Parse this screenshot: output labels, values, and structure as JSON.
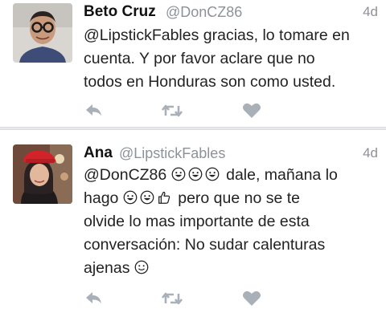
{
  "colors": {
    "name": "#111111",
    "meta": "#8d9299",
    "text": "#222222",
    "action_icon": "#a9b0b8",
    "divider": "#e6e9ec"
  },
  "tweets": [
    {
      "name": "Beto Cruz",
      "handle": "@DonCZ86",
      "time": "4d",
      "lines": [
        "@LipstickFables gracias, lo tomare en",
        "cuenta. Y por favor aclare que no",
        "todos en Honduras son como usted."
      ],
      "actions": [
        "reply-icon",
        "retweet-icon",
        "like-icon"
      ]
    },
    {
      "name": "Ana",
      "handle": "@LipstickFables",
      "time": "4d",
      "line1_text": "@DonCZ86",
      "line1_emojis": [
        "grinning-face",
        "grinning-face",
        "grinning-face"
      ],
      "line1_after": "dale, mañana lo",
      "line2_text": "hago",
      "line2_emojis": [
        "grinning-face",
        "grinning-face",
        "thumbs-up"
      ],
      "line2_after": "pero que no se te",
      "lines_rest": [
        "olvide lo mas importante de esta",
        "conversación: No sudar calenturas"
      ],
      "last_line_text": "ajenas",
      "last_line_emoji": "smiling-face",
      "actions": [
        "reply-icon",
        "retweet-icon",
        "like-icon"
      ]
    }
  ]
}
